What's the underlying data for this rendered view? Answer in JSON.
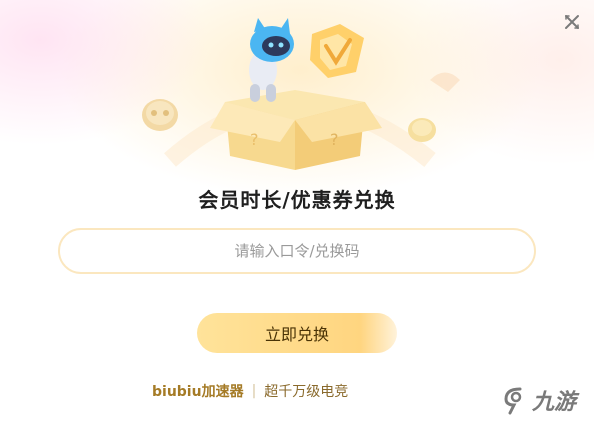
{
  "dialog": {
    "title": "会员时长/优惠券兑换",
    "input": {
      "placeholder": "请输入口令/兑换码",
      "value": ""
    },
    "submit_label": "立即兑换",
    "footer": {
      "brand": "biubiu加速器",
      "separator": "|",
      "slogan": "超千万级电竞"
    }
  },
  "watermark": {
    "text": "九游"
  },
  "icons": [
    "close-icon",
    "mascot-illustration",
    "gift-box-illustration",
    "logo-badge-icon",
    "controller-coin-icon",
    "coin-icon",
    "jiuyou-logo-icon"
  ],
  "colors": {
    "accent": "#ffd27a",
    "input_border": "#fbe7bf",
    "title": "#1f1f1f",
    "brand": "#a57b26"
  }
}
